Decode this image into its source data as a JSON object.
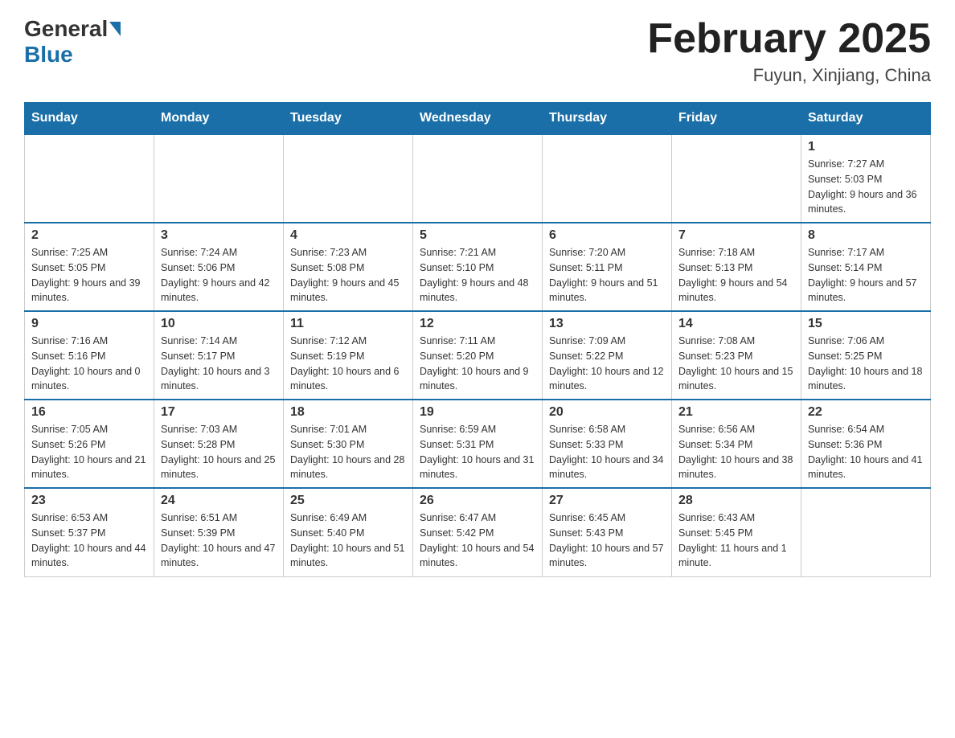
{
  "header": {
    "logo_general": "General",
    "logo_blue": "Blue",
    "month_title": "February 2025",
    "location": "Fuyun, Xinjiang, China"
  },
  "days_of_week": [
    "Sunday",
    "Monday",
    "Tuesday",
    "Wednesday",
    "Thursday",
    "Friday",
    "Saturday"
  ],
  "weeks": [
    [
      {
        "day": "",
        "sunrise": "",
        "sunset": "",
        "daylight": ""
      },
      {
        "day": "",
        "sunrise": "",
        "sunset": "",
        "daylight": ""
      },
      {
        "day": "",
        "sunrise": "",
        "sunset": "",
        "daylight": ""
      },
      {
        "day": "",
        "sunrise": "",
        "sunset": "",
        "daylight": ""
      },
      {
        "day": "",
        "sunrise": "",
        "sunset": "",
        "daylight": ""
      },
      {
        "day": "",
        "sunrise": "",
        "sunset": "",
        "daylight": ""
      },
      {
        "day": "1",
        "sunrise": "Sunrise: 7:27 AM",
        "sunset": "Sunset: 5:03 PM",
        "daylight": "Daylight: 9 hours and 36 minutes."
      }
    ],
    [
      {
        "day": "2",
        "sunrise": "Sunrise: 7:25 AM",
        "sunset": "Sunset: 5:05 PM",
        "daylight": "Daylight: 9 hours and 39 minutes."
      },
      {
        "day": "3",
        "sunrise": "Sunrise: 7:24 AM",
        "sunset": "Sunset: 5:06 PM",
        "daylight": "Daylight: 9 hours and 42 minutes."
      },
      {
        "day": "4",
        "sunrise": "Sunrise: 7:23 AM",
        "sunset": "Sunset: 5:08 PM",
        "daylight": "Daylight: 9 hours and 45 minutes."
      },
      {
        "day": "5",
        "sunrise": "Sunrise: 7:21 AM",
        "sunset": "Sunset: 5:10 PM",
        "daylight": "Daylight: 9 hours and 48 minutes."
      },
      {
        "day": "6",
        "sunrise": "Sunrise: 7:20 AM",
        "sunset": "Sunset: 5:11 PM",
        "daylight": "Daylight: 9 hours and 51 minutes."
      },
      {
        "day": "7",
        "sunrise": "Sunrise: 7:18 AM",
        "sunset": "Sunset: 5:13 PM",
        "daylight": "Daylight: 9 hours and 54 minutes."
      },
      {
        "day": "8",
        "sunrise": "Sunrise: 7:17 AM",
        "sunset": "Sunset: 5:14 PM",
        "daylight": "Daylight: 9 hours and 57 minutes."
      }
    ],
    [
      {
        "day": "9",
        "sunrise": "Sunrise: 7:16 AM",
        "sunset": "Sunset: 5:16 PM",
        "daylight": "Daylight: 10 hours and 0 minutes."
      },
      {
        "day": "10",
        "sunrise": "Sunrise: 7:14 AM",
        "sunset": "Sunset: 5:17 PM",
        "daylight": "Daylight: 10 hours and 3 minutes."
      },
      {
        "day": "11",
        "sunrise": "Sunrise: 7:12 AM",
        "sunset": "Sunset: 5:19 PM",
        "daylight": "Daylight: 10 hours and 6 minutes."
      },
      {
        "day": "12",
        "sunrise": "Sunrise: 7:11 AM",
        "sunset": "Sunset: 5:20 PM",
        "daylight": "Daylight: 10 hours and 9 minutes."
      },
      {
        "day": "13",
        "sunrise": "Sunrise: 7:09 AM",
        "sunset": "Sunset: 5:22 PM",
        "daylight": "Daylight: 10 hours and 12 minutes."
      },
      {
        "day": "14",
        "sunrise": "Sunrise: 7:08 AM",
        "sunset": "Sunset: 5:23 PM",
        "daylight": "Daylight: 10 hours and 15 minutes."
      },
      {
        "day": "15",
        "sunrise": "Sunrise: 7:06 AM",
        "sunset": "Sunset: 5:25 PM",
        "daylight": "Daylight: 10 hours and 18 minutes."
      }
    ],
    [
      {
        "day": "16",
        "sunrise": "Sunrise: 7:05 AM",
        "sunset": "Sunset: 5:26 PM",
        "daylight": "Daylight: 10 hours and 21 minutes."
      },
      {
        "day": "17",
        "sunrise": "Sunrise: 7:03 AM",
        "sunset": "Sunset: 5:28 PM",
        "daylight": "Daylight: 10 hours and 25 minutes."
      },
      {
        "day": "18",
        "sunrise": "Sunrise: 7:01 AM",
        "sunset": "Sunset: 5:30 PM",
        "daylight": "Daylight: 10 hours and 28 minutes."
      },
      {
        "day": "19",
        "sunrise": "Sunrise: 6:59 AM",
        "sunset": "Sunset: 5:31 PM",
        "daylight": "Daylight: 10 hours and 31 minutes."
      },
      {
        "day": "20",
        "sunrise": "Sunrise: 6:58 AM",
        "sunset": "Sunset: 5:33 PM",
        "daylight": "Daylight: 10 hours and 34 minutes."
      },
      {
        "day": "21",
        "sunrise": "Sunrise: 6:56 AM",
        "sunset": "Sunset: 5:34 PM",
        "daylight": "Daylight: 10 hours and 38 minutes."
      },
      {
        "day": "22",
        "sunrise": "Sunrise: 6:54 AM",
        "sunset": "Sunset: 5:36 PM",
        "daylight": "Daylight: 10 hours and 41 minutes."
      }
    ],
    [
      {
        "day": "23",
        "sunrise": "Sunrise: 6:53 AM",
        "sunset": "Sunset: 5:37 PM",
        "daylight": "Daylight: 10 hours and 44 minutes."
      },
      {
        "day": "24",
        "sunrise": "Sunrise: 6:51 AM",
        "sunset": "Sunset: 5:39 PM",
        "daylight": "Daylight: 10 hours and 47 minutes."
      },
      {
        "day": "25",
        "sunrise": "Sunrise: 6:49 AM",
        "sunset": "Sunset: 5:40 PM",
        "daylight": "Daylight: 10 hours and 51 minutes."
      },
      {
        "day": "26",
        "sunrise": "Sunrise: 6:47 AM",
        "sunset": "Sunset: 5:42 PM",
        "daylight": "Daylight: 10 hours and 54 minutes."
      },
      {
        "day": "27",
        "sunrise": "Sunrise: 6:45 AM",
        "sunset": "Sunset: 5:43 PM",
        "daylight": "Daylight: 10 hours and 57 minutes."
      },
      {
        "day": "28",
        "sunrise": "Sunrise: 6:43 AM",
        "sunset": "Sunset: 5:45 PM",
        "daylight": "Daylight: 11 hours and 1 minute."
      },
      {
        "day": "",
        "sunrise": "",
        "sunset": "",
        "daylight": ""
      }
    ]
  ]
}
